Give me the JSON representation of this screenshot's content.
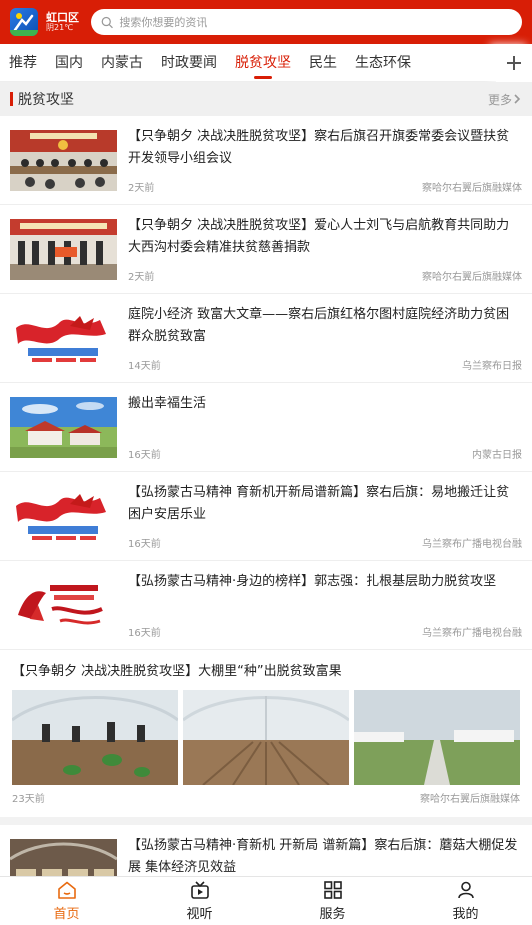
{
  "header": {
    "location": "虹口区",
    "weather": "阴21℃",
    "search_placeholder": "搜索你想要的资讯"
  },
  "tabs": [
    "推荐",
    "国内",
    "内蒙古",
    "时政要闻",
    "脱贫攻坚",
    "民生",
    "生态环保"
  ],
  "active_tab": "脱贫攻坚",
  "section": {
    "title": "脱贫攻坚",
    "more": "更多"
  },
  "articles": [
    {
      "title": "【只争朝夕 决战决胜脱贫攻坚】察右后旗召开旗委常委会议暨扶贫开发领导小组会议",
      "time": "2天前",
      "source": "察哈尔右翼后旗融媒体",
      "thumb": "meeting-photo"
    },
    {
      "title": "【只争朝夕 决战决胜脱贫攻坚】爱心人士刘飞与启航教育共同助力大西沟村委会精准扶贫慈善捐款",
      "time": "2天前",
      "source": "察哈尔右翼后旗融媒体",
      "thumb": "donation-photo"
    },
    {
      "title": "庭院小经济 致富大文章——察右后旗红格尔图村庭院经济助力贫困群众脱贫致富",
      "time": "14天前",
      "source": "乌兰察布日报",
      "thumb": "campaign-banner"
    },
    {
      "title": "搬出幸福生活",
      "time": "16天前",
      "source": "内蒙古日报",
      "thumb": "village-houses"
    },
    {
      "title": "【弘扬蒙古马精神 育新机开新局谱新篇】察右后旗：易地搬迁让贫困户安居乐业",
      "time": "16天前",
      "source": "乌兰察布广播电视台融",
      "thumb": "campaign-banner"
    },
    {
      "title": "【弘扬蒙古马精神·身边的榜样】郭志强：扎根基层助力脱贫攻坚",
      "time": "16天前",
      "source": "乌兰察布广播电视台融",
      "thumb": "horse-calligraphy"
    }
  ],
  "wide_article": {
    "title": "【只争朝夕 决战决胜脱贫攻坚】大棚里“种”出脱贫致富果",
    "time": "23天前",
    "source": "察哈尔右翼后旗融媒体",
    "images": [
      "greenhouse-planting",
      "greenhouse-soil",
      "greenhouse-road"
    ]
  },
  "partial_article": {
    "title": "【弘扬蒙古马精神·育新机 开新局 谱新篇】察右后旗：蘑菇大棚促发展 集体经济见效益",
    "thumb": "mushroom-greenhouse"
  },
  "bottom_nav": [
    {
      "label": "首页",
      "icon": "home-icon",
      "active": true
    },
    {
      "label": "视听",
      "icon": "video-icon",
      "active": false
    },
    {
      "label": "服务",
      "icon": "grid-icon",
      "active": false
    },
    {
      "label": "我的",
      "icon": "user-icon",
      "active": false
    }
  ],
  "colors": {
    "brand_red": "#d81e06",
    "nav_active": "#e86a10"
  }
}
